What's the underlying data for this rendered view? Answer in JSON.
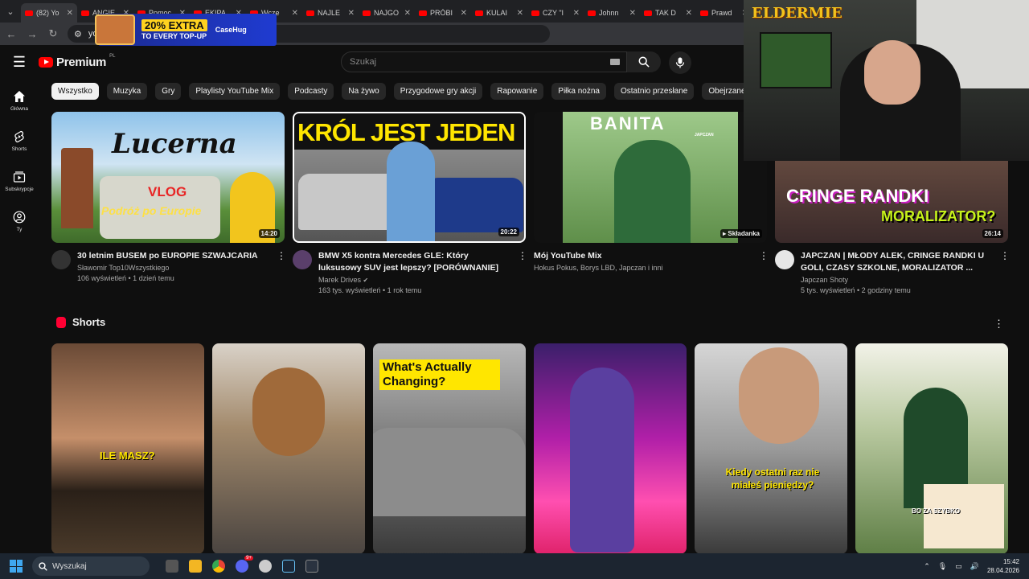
{
  "browser": {
    "tabs": [
      {
        "label": "(82) Yo",
        "active": true
      },
      {
        "label": "ANGIE",
        "active": false
      },
      {
        "label": "Pomoc",
        "active": false
      },
      {
        "label": "EKIPA",
        "active": false
      },
      {
        "label": "Wcze",
        "active": false
      },
      {
        "label": "NAJLE",
        "active": false
      },
      {
        "label": "NAJGO",
        "active": false
      },
      {
        "label": "PRÓBI",
        "active": false
      },
      {
        "label": "KULAI",
        "active": false
      },
      {
        "label": "CZY \"I",
        "active": false
      },
      {
        "label": "Johnn",
        "active": false
      },
      {
        "label": "TAK D",
        "active": false
      },
      {
        "label": "Prawd",
        "active": false
      }
    ],
    "close_glyph": "✕",
    "url": "yout"
  },
  "ad": {
    "headline": "20% EXTRA",
    "subline": "TO EVERY TOP-UP",
    "brand": "CaseHug"
  },
  "header": {
    "logo_text": "Premium",
    "region": "PL",
    "search_placeholder": "Szukaj"
  },
  "sidebar": [
    {
      "label": "Główna",
      "icon": "home-icon"
    },
    {
      "label": "Shorts",
      "icon": "shorts-icon"
    },
    {
      "label": "Subskrypcje",
      "icon": "subscriptions-icon"
    },
    {
      "label": "Ty",
      "icon": "user-icon"
    }
  ],
  "chips": [
    "Wszystko",
    "Muzyka",
    "Gry",
    "Playlisty YouTube Mix",
    "Podcasty",
    "Na żywo",
    "Przygodowe gry akcji",
    "Rapowanie",
    "Piłka nożna",
    "Ostatnio przesłane",
    "Obejrzane",
    "Nowe r"
  ],
  "videos": [
    {
      "title": "30 letnim BUSEM po EUROPIE   SZWAJCARIA",
      "channel": "Sławomir Top10Wszystkiego",
      "stats": "106 wyświetleń • 1 dzień temu",
      "duration": "14:20",
      "thumb_text": "Lucerna",
      "thumb_sub": "Podróż po Europie",
      "thumb_badge": "VLOG"
    },
    {
      "title": "BMW X5 kontra Mercedes GLE: Który luksusowy SUV jest lepszy? [PORÓWNANIE]",
      "channel": "Marek Drives",
      "stats": "163 tys. wyświetleń • 1 rok temu",
      "duration": "20:22",
      "thumb_text": "KRÓL JEST JEDEN"
    },
    {
      "title": "Mój YouTube Mix",
      "channel": "Hokus Pokus, Borys LBD, Japczan i inni",
      "stats": "",
      "duration": "Składanka",
      "thumb_text": "BANITA",
      "thumb_sub": "JAPCZAN"
    },
    {
      "title": "JAPCZAN | MŁODY ALEK, CRINGE RANDKI U GOLI, CZASY SZKOLNE, MORALIZATOR ...",
      "channel": "Japczan Shoty",
      "stats": "5 tys. wyświetleń • 2 godziny temu",
      "duration": "26:14",
      "thumb_text": "CRINGE RANDKI",
      "thumb_sub": "MORALIZATOR?"
    }
  ],
  "shorts": {
    "title": "Shorts",
    "items": [
      {
        "caption": "ILE MASZ?"
      },
      {
        "caption": ""
      },
      {
        "caption": "What's Actually Changing?"
      },
      {
        "caption": ""
      },
      {
        "caption": "Kiedy ostatni raz nie miałeś pieniędzy?"
      },
      {
        "caption": "BO ZA SZYBKO"
      }
    ]
  },
  "webcam": {
    "logo": "ELDERMIE"
  },
  "taskbar": {
    "search_label": "Wyszukaj",
    "badge": "9+",
    "time": "15:42",
    "date": "28.04.2026"
  }
}
